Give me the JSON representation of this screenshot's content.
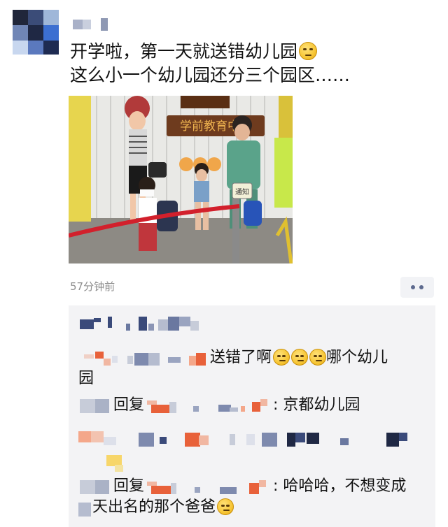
{
  "post": {
    "line1": "开学啦，第一天就送错幼儿园",
    "line2": "这么小一个幼儿园还分三个园区……",
    "time": "57分钟前",
    "line1_emoji": "raised-eyebrow-face"
  },
  "photo": {
    "sign_text": "学前教育中心",
    "card_text": "通知"
  },
  "comments": [
    {
      "text_after": "送错了啊",
      "text_tail": "哪个幼儿",
      "text_wrap": "园",
      "emoji": "thinking-face"
    },
    {
      "reply_word": "回复",
      "text": ": 京都幼儿园"
    },
    {
      "reply_word": "回复",
      "text": ": 哈哈哈，不想变成",
      "text_wrap": "天出名的那个爸爸",
      "emoji": "thinking-face"
    }
  ],
  "colors": {
    "mosaic_dark": "#3a4a7a",
    "mosaic_orange": "#e8613a",
    "comment_bg": "#f3f3f5",
    "timestamp": "#8e8e8e"
  }
}
